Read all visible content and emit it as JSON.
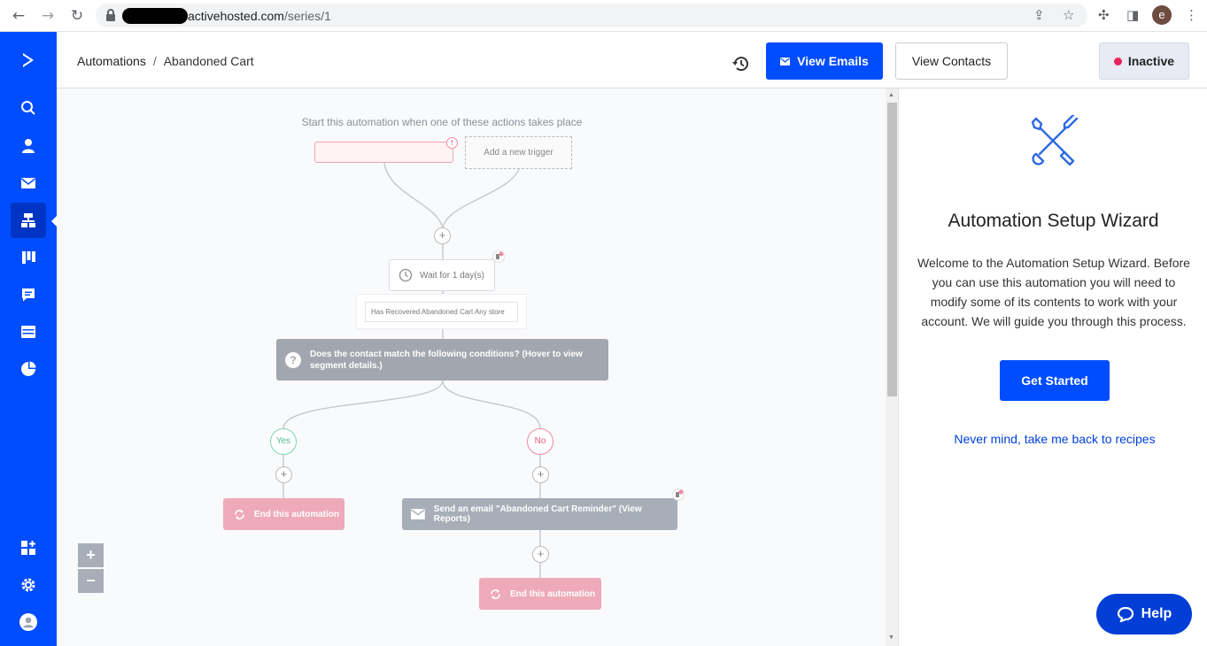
{
  "browser": {
    "url_host": "activehosted.com",
    "url_path": "/series/1",
    "profile_initial": "e"
  },
  "nav": {
    "items": [
      "logo",
      "search",
      "contacts",
      "campaigns",
      "automations",
      "deals",
      "conversations",
      "website",
      "reports",
      "apps",
      "settings",
      "account"
    ],
    "active": "automations"
  },
  "header": {
    "breadcrumb_root": "Automations",
    "breadcrumb_sep": "/",
    "breadcrumb_current": "Abandoned Cart",
    "view_emails_label": "View Emails",
    "view_contacts_label": "View Contacts",
    "status_label": "Inactive",
    "status_color": "#e8235e"
  },
  "flow": {
    "trigger_title": "Start this automation when one of these actions takes place",
    "trigger_alert": "!",
    "add_trigger_label": "Add a new trigger",
    "plus": "+",
    "wait_label": "Wait for 1 day(s)",
    "goal_label": "Has Recovered Abandoned Cart Any store",
    "condition_text": "Does the contact match the following conditions? (Hover to view segment details.)",
    "yes_label": "Yes",
    "no_label": "No",
    "end_yes_label": "End this automation",
    "email_label": "Send an email \"Abandoned Cart Reminder\" (View Reports)",
    "end_no_label": "End this automation",
    "zoom_in": "+",
    "zoom_out": "−"
  },
  "panel": {
    "title": "Automation Setup Wizard",
    "text": "Welcome to the Automation Setup Wizard. Before you can use this automation you will need to modify some of its contents to work with your account. We will guide you through this process.",
    "get_started_label": "Get Started",
    "back_link": "Never mind, take me back to recipes"
  },
  "help": {
    "label": "Help"
  },
  "colors": {
    "brand": "#004cff",
    "end_node": "#eeaab9",
    "condition_node": "#a2a6ae"
  }
}
